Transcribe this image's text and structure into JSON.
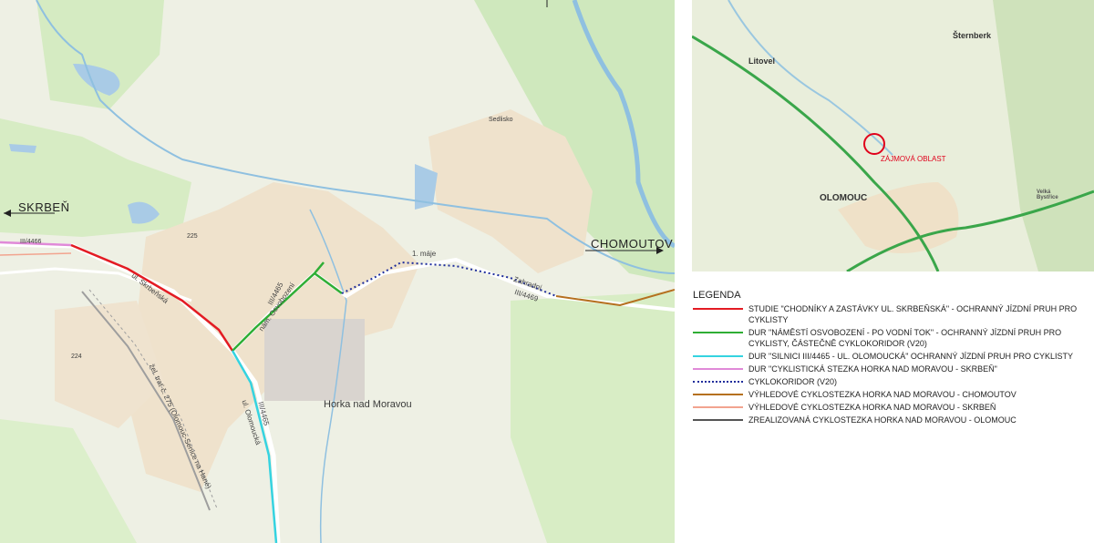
{
  "main_map": {
    "direction_labels": {
      "skrben": "SKRBEŇ",
      "chomoutov": "CHOMOUTOV"
    },
    "place_labels": {
      "town": "Horka nad Moravou",
      "sedlisko": "Sedlisko",
      "road_3_4466": "III/4466",
      "road_3_4465": "III/4465",
      "road_3_4465_b": "III/4465",
      "road_3_4469": "III/4469",
      "street_skrbenska": "ul. Skrbeňská",
      "street_olomoucka": "ul. Olomoucká",
      "street_nam": "nám. Osvobození",
      "street_1maje": "1. máje",
      "street_zahradni": "Zahradní",
      "railway": "žel. trať č. 275 (Olomouc-Senice na Hané)",
      "num_225": "225",
      "num_224": "224"
    }
  },
  "overview_map": {
    "labels": {
      "litovel": "Litovel",
      "sternberk": "Šternberk",
      "olomouc": "OLOMOUC",
      "velka_bystrice": "Velká Bystřice",
      "zajmova_oblast": "ZÁJMOVÁ OBLAST"
    },
    "colors": {
      "marker": "#e0001b",
      "road": "#3aa64a"
    }
  },
  "legend": {
    "title": "LEGENDA",
    "items": [
      {
        "text": "STUDIE \"CHODNÍKY A ZASTÁVKY UL. SKRBEŇSKÁ\" - OCHRANNÝ JÍZDNÍ PRUH PRO CYKLISTY",
        "color": "#e31b23",
        "style": "solid"
      },
      {
        "text": "DUR \"NÁMĚSTÍ OSVOBOZENÍ - PO VODNÍ TOK\" - OCHRANNÝ JÍZDNÍ PRUH PRO CYKLISTY, ČÁSTEČNĚ CYKLOKORIDOR (V20)",
        "color": "#2fae35",
        "style": "solid"
      },
      {
        "text": "DUR \"SILNICI III/4465 - UL. OLOMOUCKÁ\" OCHRANNÝ JÍZDNÍ PRUH PRO CYKLISTY",
        "color": "#35d3e0",
        "style": "solid"
      },
      {
        "text": "DUR \"CYKLISTICKÁ STEZKA HORKA NAD MORAVOU - SKRBEŇ\"",
        "color": "#e08ad8",
        "style": "solid"
      },
      {
        "text": "CYKLOKORIDOR (V20)",
        "color": "#1f2e9c",
        "style": "dotted"
      },
      {
        "text": "VÝHLEDOVÉ CYKLOSTEZKA HORKA NAD MORAVOU - CHOMOUTOV",
        "color": "#b5701f",
        "style": "solid"
      },
      {
        "text": "VÝHLEDOVÉ CYKLOSTEZKA HORKA NAD MORAVOU - SKRBEŇ",
        "color": "#f2a48f",
        "style": "solid"
      },
      {
        "text": "ZREALIZOVANÁ CYKLOSTEZKA HORKA NAD MORAVOU - OLOMOUC",
        "color": "#555555",
        "style": "solid"
      }
    ]
  }
}
